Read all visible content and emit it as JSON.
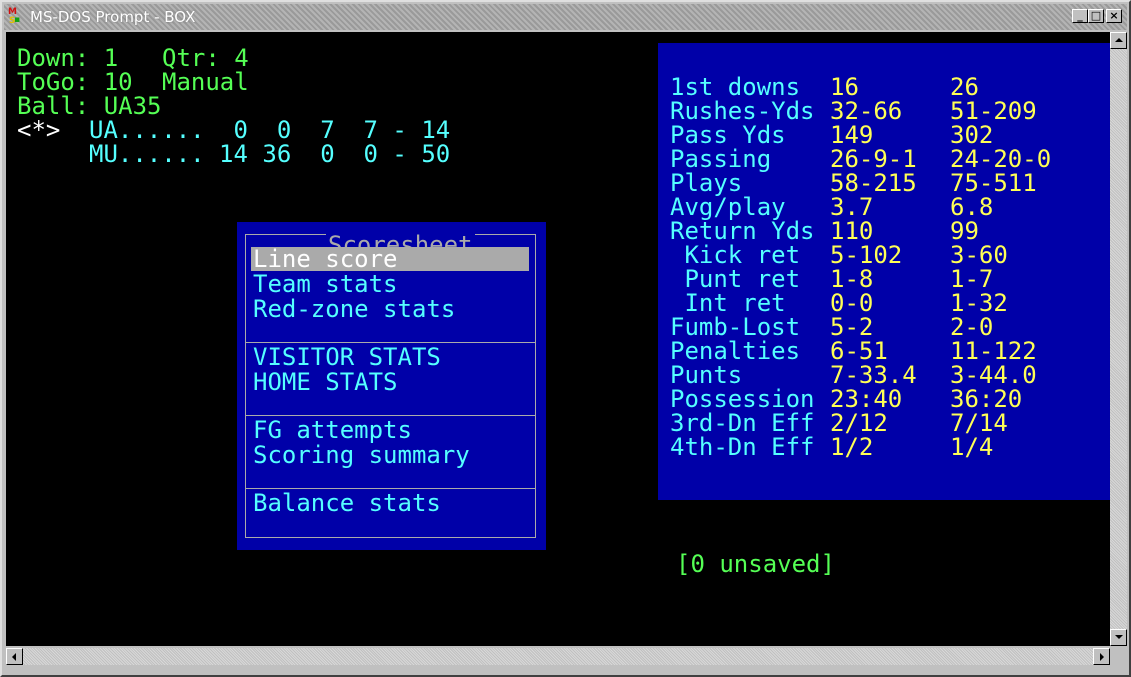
{
  "window": {
    "title": "MS-DOS Prompt - BOX",
    "buttons": {
      "minimize": "_",
      "maximize": "□",
      "close": "×"
    }
  },
  "status": {
    "down_label": "Down: 1",
    "qtr_label": "Qtr: 4",
    "togo_label": "ToGo: 10",
    "mode": "Manual",
    "ball": "Ball: UA35",
    "possession_marker": "<*>",
    "linescore": [
      {
        "text": "UA......  0  0  7  7 - 14"
      },
      {
        "text": "MU...... 14 36  0  0 - 50"
      }
    ]
  },
  "team_stats": {
    "rows": [
      {
        "label": "1st downs",
        "v1": "16",
        "v2": "26"
      },
      {
        "label": "Rushes-Yds",
        "v1": "32-66",
        "v2": "51-209"
      },
      {
        "label": "Pass Yds",
        "v1": "149",
        "v2": "302"
      },
      {
        "label": "Passing",
        "v1": "26-9-1",
        "v2": "24-20-0"
      },
      {
        "label": "Plays",
        "v1": "58-215",
        "v2": "75-511"
      },
      {
        "label": "Avg/play",
        "v1": "3.7",
        "v2": "6.8"
      },
      {
        "label": "Return Yds",
        "v1": "110",
        "v2": "99"
      },
      {
        "label": " Kick ret",
        "v1": "5-102",
        "v2": "3-60"
      },
      {
        "label": " Punt ret",
        "v1": "1-8",
        "v2": "1-7"
      },
      {
        "label": " Int ret",
        "v1": "0-0",
        "v2": "1-32"
      },
      {
        "label": "Fumb-Lost",
        "v1": "5-2",
        "v2": "2-0"
      },
      {
        "label": "Penalties",
        "v1": "6-51",
        "v2": "11-122"
      },
      {
        "label": "Punts",
        "v1": "7-33.4",
        "v2": "3-44.0"
      },
      {
        "label": "Possession",
        "v1": "23:40",
        "v2": "36:20"
      },
      {
        "label": "3rd-Dn Eff",
        "v1": "2/12",
        "v2": "7/14"
      },
      {
        "label": "4th-Dn Eff",
        "v1": "1/2",
        "v2": "1/4"
      }
    ]
  },
  "menu": {
    "title": "Scoresheet",
    "groups": [
      [
        "Line score",
        "Team stats",
        "Red-zone stats"
      ],
      [
        "VISITOR STATS",
        "HOME STATS"
      ],
      [
        "FG attempts",
        "Scoring summary"
      ],
      [
        "Balance stats"
      ]
    ],
    "selected": "Line score"
  },
  "footer": {
    "unsaved": "[0 unsaved]"
  },
  "colors": {
    "console_bg": "#000000",
    "panel_bg": "#0000a8",
    "green": "#55ff55",
    "cyan": "#55ffff",
    "yellow": "#ffff55",
    "highlight": "#aaaaaa"
  }
}
